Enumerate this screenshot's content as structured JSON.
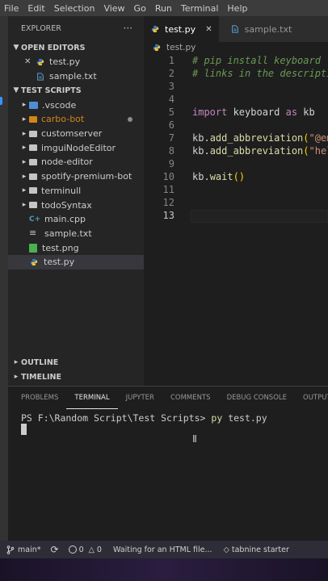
{
  "menu": [
    "File",
    "Edit",
    "Selection",
    "View",
    "Go",
    "Run",
    "Terminal",
    "Help"
  ],
  "explorer": {
    "title": "EXPLORER",
    "more": "···",
    "open_editors_label": "OPEN EDITORS",
    "open_editors": [
      {
        "name": "test.py",
        "close": "✕",
        "icon": "python-icon"
      },
      {
        "name": "sample.txt",
        "icon": "file-icon"
      }
    ],
    "folder_label": "TEST SCRIPTS",
    "items": [
      {
        "name": ".vscode",
        "type": "folder"
      },
      {
        "name": "carbo-bot",
        "type": "folder",
        "modified": true
      },
      {
        "name": "customserver",
        "type": "folder"
      },
      {
        "name": "imguiNodeEditor",
        "type": "folder"
      },
      {
        "name": "node-editor",
        "type": "folder"
      },
      {
        "name": "spotify-premium-bot",
        "type": "folder"
      },
      {
        "name": "terminull",
        "type": "folder"
      },
      {
        "name": "todoSyntax",
        "type": "folder"
      },
      {
        "name": "main.cpp",
        "type": "cpp"
      },
      {
        "name": "sample.txt",
        "type": "txt"
      },
      {
        "name": "test.png",
        "type": "png"
      },
      {
        "name": "test.py",
        "type": "py",
        "selected": true
      }
    ],
    "outline_label": "OUTLINE",
    "timeline_label": "TIMELINE"
  },
  "tabs": [
    {
      "name": "test.py",
      "close": "✕",
      "active": true
    },
    {
      "name": "sample.txt",
      "active": false
    }
  ],
  "breadcrumb": "test.py",
  "editor": {
    "line_numbers": [
      "1",
      "2",
      "3",
      "4",
      "5",
      "6",
      "7",
      "8",
      "9",
      "10",
      "11",
      "12",
      "13"
    ],
    "current_line": "13",
    "lines": {
      "l1": "# pip install keyboard",
      "l2": "# links in the description",
      "l5_kw1": "import",
      "l5_mod": " keyboard ",
      "l5_kw2": "as",
      "l5_alias": " kb",
      "l7_obj": "kb.",
      "l7_fn": "add_abbreviation",
      "l7_p": "(",
      "l7_str": "\"@email\"",
      "l8_obj": "kb.",
      "l8_fn": "add_abbreviation",
      "l8_p": "(",
      "l8_str": "\"hello\"",
      "l10_obj": "kb.",
      "l10_fn": "wait",
      "l10_p": "()"
    }
  },
  "panel": {
    "tabs": [
      "PROBLEMS",
      "TERMINAL",
      "JUPYTER",
      "COMMENTS",
      "DEBUG CONSOLE",
      "OUTPUT"
    ],
    "active_tab": "TERMINAL",
    "prompt": "PS F:\\Random Script\\Test Scripts> ",
    "cmd_exe": "py",
    "cmd_arg": " test.py"
  },
  "status": {
    "branch": "main*",
    "sync": "⟳",
    "errors": "0",
    "warnings": "0",
    "message": "Waiting for an HTML file...",
    "tabnine": "tabnine starter"
  }
}
